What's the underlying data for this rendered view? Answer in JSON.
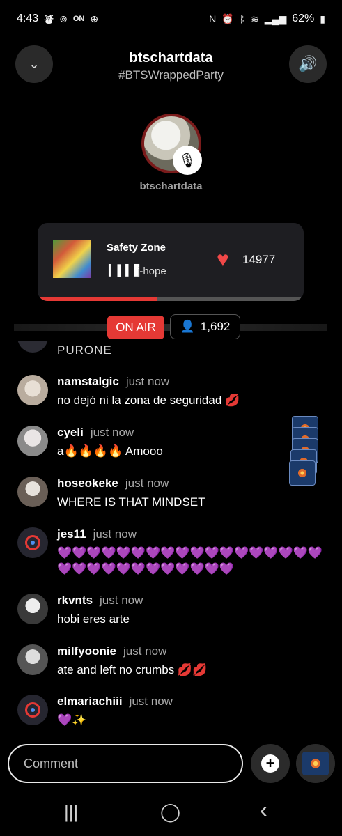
{
  "status_bar": {
    "time": "4:43",
    "battery": "62%",
    "left_icons": [
      "notification-icon",
      "shazam-icon",
      "on-icon",
      "data-saver-icon"
    ],
    "right_icons": [
      "nfc-icon",
      "alarm-icon",
      "bluetooth-icon",
      "wifi-icon",
      "signal-icon",
      "battery-icon"
    ]
  },
  "header": {
    "title": "btschartdata",
    "subtitle": "#BTSWrappedParty",
    "collapse_icon": "chevron-down-icon",
    "volume_icon": "speaker-icon"
  },
  "host": {
    "name": "btschartdata",
    "muted": true
  },
  "now_playing": {
    "title": "Safety Zone",
    "artist": "j-hope",
    "likes": "14977",
    "progress": 0.45,
    "accent": "#e53935"
  },
  "live": {
    "badge": "ON AIR",
    "listeners": "1,692"
  },
  "chat": {
    "partial_text": "PURONE",
    "messages": [
      {
        "user": "namstalgic",
        "time": "just now",
        "text": "no dejó ni la zona de seguridad 💋"
      },
      {
        "user": "cyeli",
        "time": "just now",
        "text": "a🔥🔥🔥🔥 Amooo"
      },
      {
        "user": "hoseokeke",
        "time": "just now",
        "text": "WHERE IS THAT MINDSET"
      },
      {
        "user": "jes11",
        "time": "just now",
        "text": "💜💜💜💜💜💜💜💜💜💜💜💜💜💜💜💜💜💜💜💜💜💜💜💜💜💜💜💜💜💜"
      },
      {
        "user": "rkvnts",
        "time": "just now",
        "text": "hobi eres arte"
      },
      {
        "user": "milfyoonie",
        "time": "just now",
        "text": "ate and left no crumbs 💋💋"
      },
      {
        "user": "elmariachiii",
        "time": "just now",
        "text": "💜✨"
      }
    ]
  },
  "composer": {
    "placeholder": "Comment",
    "add_icon": "plus-icon",
    "gift_icon": "fireworks-icon"
  },
  "nav": {
    "recents": "|||",
    "home": "◯",
    "back": "‹"
  }
}
